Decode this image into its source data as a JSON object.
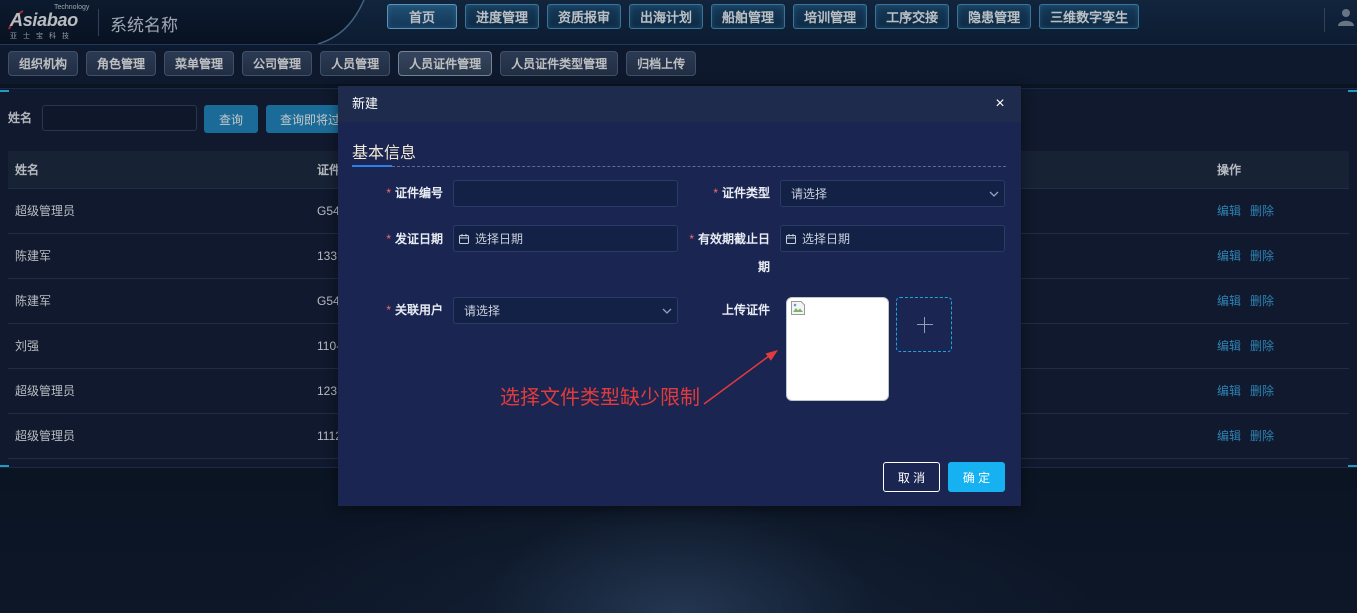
{
  "colors": {
    "accent": "#16b1f0",
    "required": "#f56c6c",
    "annotation": "#e23b3b",
    "link": "#3ba8e6",
    "dialog_bg": "#1b2551"
  },
  "header": {
    "logo": {
      "brand": "Asiabao",
      "tagline": "Technology",
      "cn": "亚士宝科技"
    },
    "system_name": "系统名称",
    "nav": [
      {
        "label": "首页",
        "active": true
      },
      {
        "label": "进度管理",
        "active": false
      },
      {
        "label": "资质报审",
        "active": false
      },
      {
        "label": "出海计划",
        "active": false
      },
      {
        "label": "船舶管理",
        "active": false
      },
      {
        "label": "培训管理",
        "active": false
      },
      {
        "label": "工序交接",
        "active": false
      },
      {
        "label": "隐患管理",
        "active": false
      },
      {
        "label": "三维数字孪生",
        "active": false
      }
    ],
    "user_icon": "user-icon"
  },
  "tabs": [
    {
      "label": "组织机构",
      "active": false
    },
    {
      "label": "角色管理",
      "active": false
    },
    {
      "label": "菜单管理",
      "active": false
    },
    {
      "label": "公司管理",
      "active": false
    },
    {
      "label": "人员管理",
      "active": false
    },
    {
      "label": "人员证件管理",
      "active": true
    },
    {
      "label": "人员证件类型管理",
      "active": false
    },
    {
      "label": "归档上传",
      "active": false
    }
  ],
  "search": {
    "label": "姓名",
    "value": "",
    "query_button": "查询",
    "upcoming_button": "查询即将过"
  },
  "table": {
    "columns": {
      "name": "姓名",
      "cert": "证件",
      "actions": "操作"
    },
    "rows": [
      {
        "name": "超级管理员",
        "cert": "G54",
        "edit": "编辑",
        "delete": "删除"
      },
      {
        "name": "陈建军",
        "cert": "133",
        "edit": "编辑",
        "delete": "删除"
      },
      {
        "name": "陈建军",
        "cert": "G54",
        "edit": "编辑",
        "delete": "删除"
      },
      {
        "name": "刘强",
        "cert": "110-",
        "edit": "编辑",
        "delete": "删除"
      },
      {
        "name": "超级管理员",
        "cert": "123",
        "edit": "编辑",
        "delete": "删除"
      },
      {
        "name": "超级管理员",
        "cert": "1112",
        "edit": "编辑",
        "delete": "删除"
      }
    ]
  },
  "modal": {
    "title": "新建",
    "close": "×",
    "section_title": "基本信息",
    "required_mark": "*",
    "fields": {
      "cert_no": {
        "label": "证件编号",
        "required": true,
        "value": ""
      },
      "cert_type": {
        "label": "证件类型",
        "required": true,
        "placeholder": "请选择",
        "icon": "chevron-down-icon"
      },
      "issue_date": {
        "label": "发证日期",
        "required": true,
        "placeholder": "选择日期",
        "icon": "calendar-icon"
      },
      "expiry_date": {
        "label": "有效期截止日期",
        "required": true,
        "placeholder": "选择日期",
        "icon": "calendar-icon"
      },
      "linked_user": {
        "label": "关联用户",
        "required": true,
        "placeholder": "请选择",
        "icon": "chevron-down-icon"
      },
      "upload": {
        "label": "上传证件",
        "required": false,
        "thumbnail_icon": "broken-image-icon",
        "add_icon": "plus-icon"
      }
    },
    "buttons": {
      "cancel": "取 消",
      "confirm": "确 定"
    }
  },
  "annotation": {
    "text": "选择文件类型缺少限制",
    "icon": "arrow-icon"
  }
}
